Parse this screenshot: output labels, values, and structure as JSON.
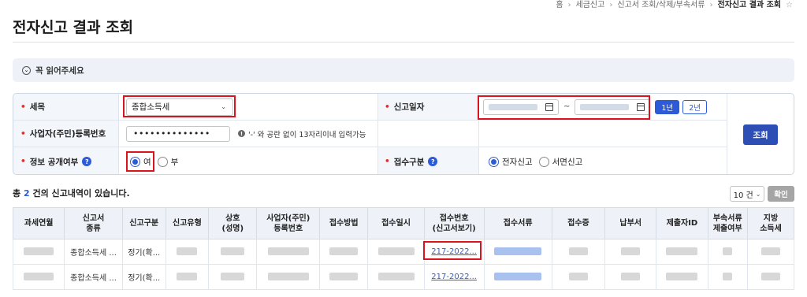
{
  "breadcrumb": {
    "items": [
      "홈",
      "세금신고",
      "신고서 조회/삭제/부속서류",
      "전자신고 결과 조회"
    ],
    "star": "☆"
  },
  "page_title": "전자신고 결과 조회",
  "notice": {
    "icon": "chevron-down-circle-icon",
    "label": "꼭 읽어주세요"
  },
  "form": {
    "tax_item": {
      "label": "세목",
      "value": "종합소득세"
    },
    "filing_date": {
      "label": "신고일자",
      "separator": "~",
      "btn_1y": "1년",
      "btn_2y": "2년"
    },
    "business_no": {
      "label": "사업자(주민)등록번호",
      "value": "••••••••••••••",
      "hint": "'-' 와 공란 없이 13자리이내 입력가능"
    },
    "disclosure": {
      "label": "정보 공개여부",
      "options": [
        "여",
        "부"
      ],
      "selected": "여"
    },
    "receipt_type": {
      "label": "접수구분",
      "options": [
        "전자신고",
        "서면신고"
      ],
      "selected": "전자신고"
    },
    "search_label": "조회"
  },
  "summary": {
    "prefix": "총",
    "count": "2",
    "suffix": "건의 신고내역이 있습니다."
  },
  "page_size": "10 건",
  "confirm_label": "확인",
  "table": {
    "headers": [
      [
        "과세연월"
      ],
      [
        "신고서",
        "종류"
      ],
      [
        "신고구분"
      ],
      [
        "신고유형"
      ],
      [
        "상호",
        "(성명)"
      ],
      [
        "사업자(주민)",
        "등록번호"
      ],
      [
        "접수방법"
      ],
      [
        "접수일시"
      ],
      [
        "접수번호",
        "(신고서보기)"
      ],
      [
        "접수서류"
      ],
      [
        "접수증"
      ],
      [
        "납부서"
      ],
      [
        "제출자ID"
      ],
      [
        "부속서류",
        "제출여부"
      ],
      [
        "지방",
        "소득세"
      ]
    ],
    "rows": [
      {
        "type": "종합소득세 ...",
        "category": "정기(확...",
        "receipt_no": "217-2022..."
      },
      {
        "type": "종합소득세 ...",
        "category": "정기(확...",
        "receipt_no": "217-2022..."
      }
    ]
  }
}
